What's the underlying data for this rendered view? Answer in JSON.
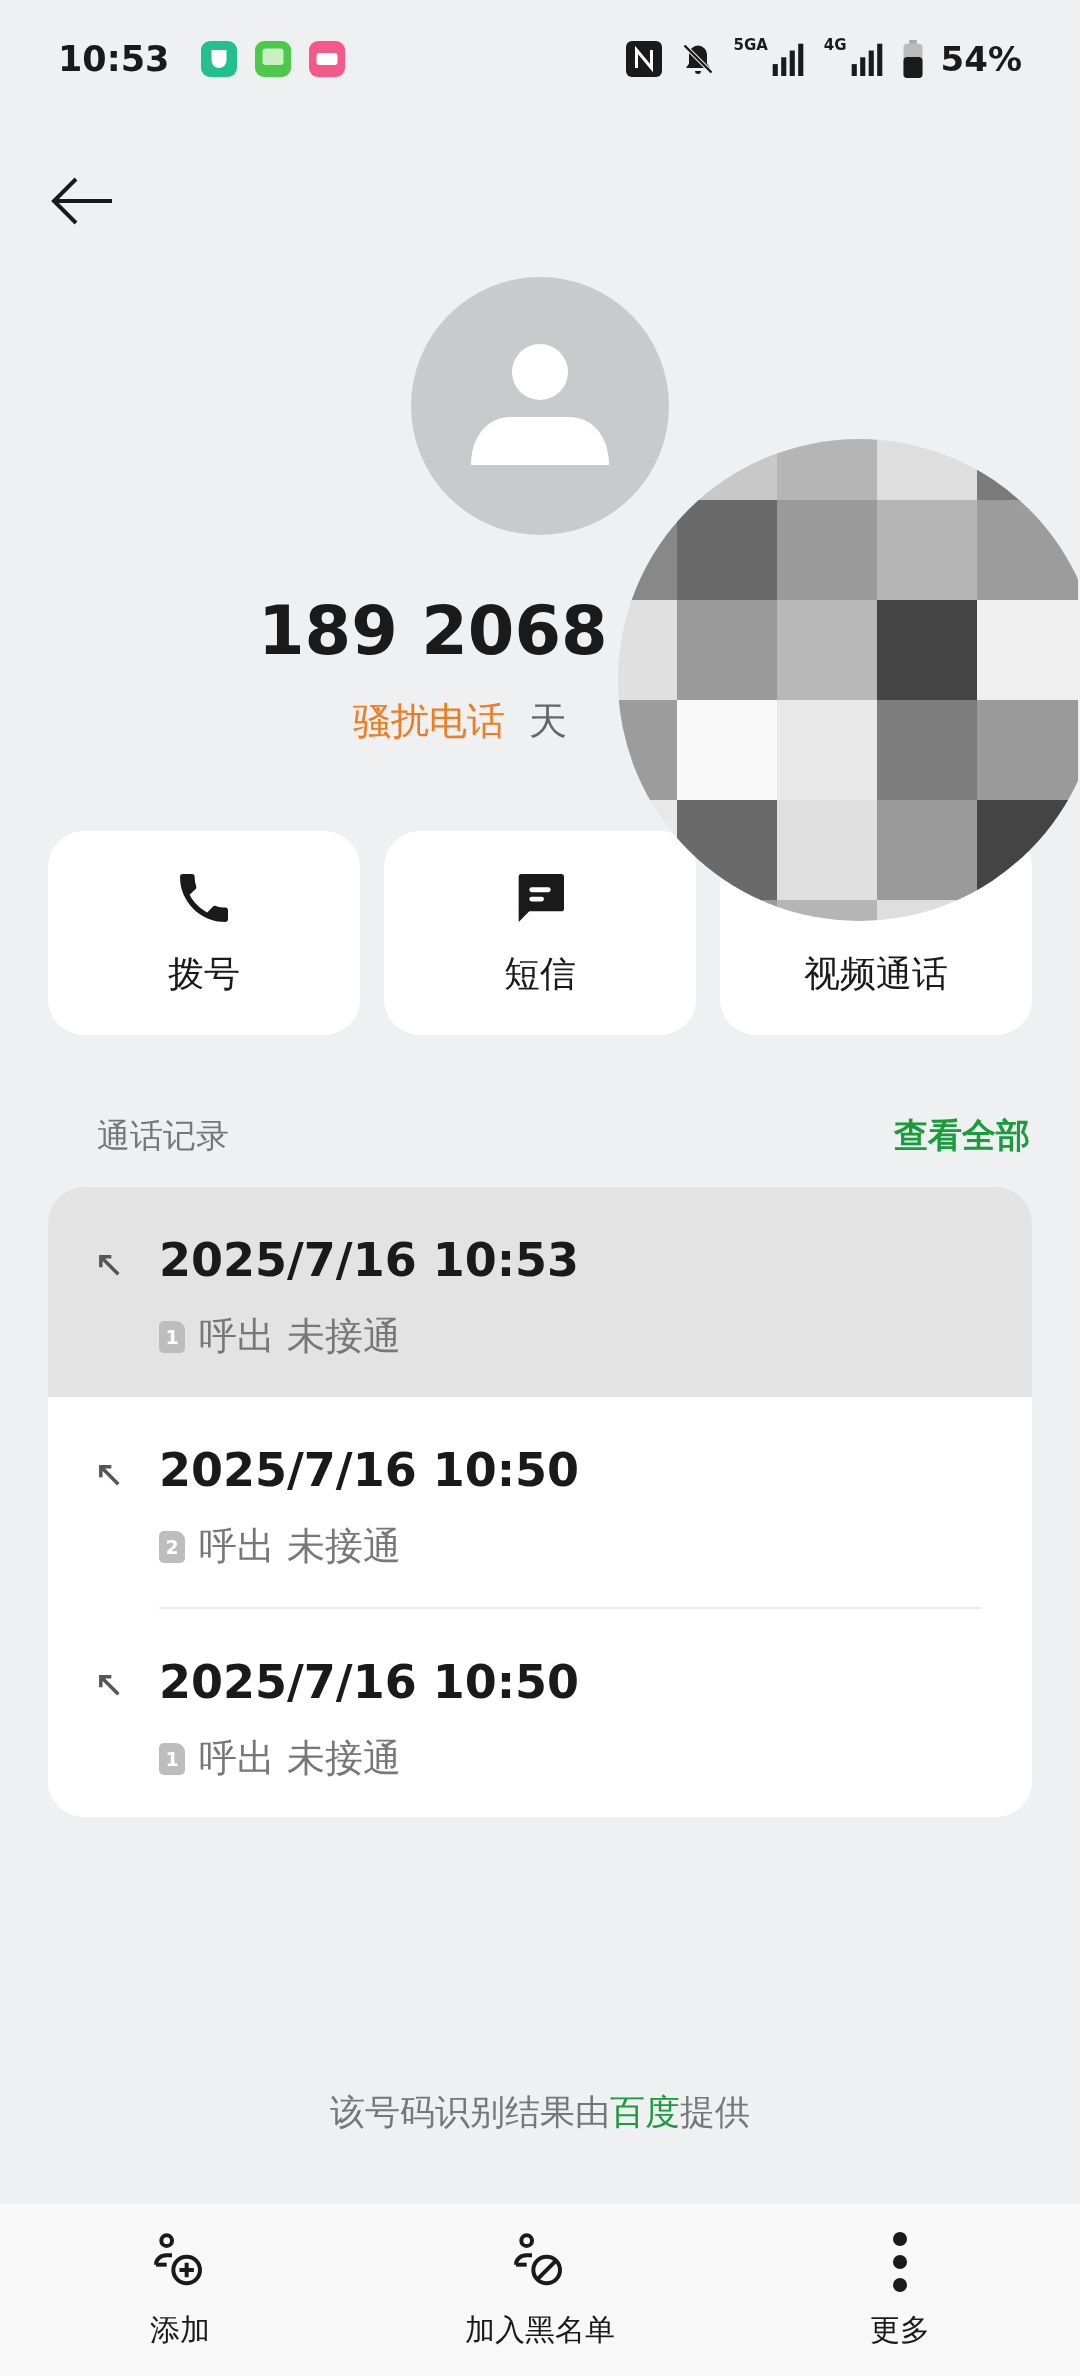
{
  "status_bar": {
    "time": "10:53",
    "network_labels": [
      "5GA",
      "4G"
    ],
    "battery": "54%"
  },
  "contact": {
    "number": "189 2068",
    "tag": "骚扰电话",
    "location": "天"
  },
  "actions": [
    {
      "kind": "call",
      "label": "拨号"
    },
    {
      "kind": "message",
      "label": "短信"
    },
    {
      "kind": "video",
      "label": "视频通话"
    }
  ],
  "history": {
    "title": "通话记录",
    "view_all": "查看全部",
    "calls": [
      {
        "time": "2025/7/16 10:53",
        "sim": "1",
        "status": "呼出 未接通",
        "selected": true
      },
      {
        "time": "2025/7/16 10:50",
        "sim": "2",
        "status": "呼出 未接通",
        "selected": false
      },
      {
        "time": "2025/7/16 10:50",
        "sim": "1",
        "status": "呼出 未接通",
        "selected": false
      }
    ]
  },
  "footer_note": {
    "before": "该号码识别结果由",
    "link": "百度",
    "after": "提供"
  },
  "bottom_bar": [
    {
      "kind": "add",
      "label": "添加"
    },
    {
      "kind": "block",
      "label": "加入黑名单"
    },
    {
      "kind": "more",
      "label": "更多"
    }
  ]
}
